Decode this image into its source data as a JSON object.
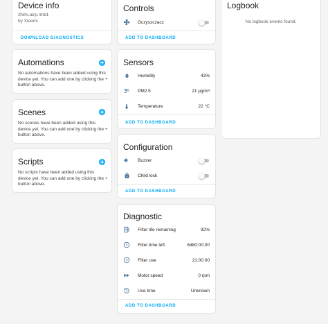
{
  "colors": {
    "accent": "#03a9f4",
    "icon": "#44739e",
    "background": "#f4f4f4"
  },
  "device_info": {
    "title": "Device info",
    "model": "zhimi.airp.rmb1",
    "manufacturer": "by Xiaomi",
    "download_label": "DOWNLOAD DIAGNOSTICS"
  },
  "automations": {
    "title": "Automations",
    "empty_text": "No automations have been added using this device yet. You can add one by clicking the + button above.",
    "add_icon": "plus-icon"
  },
  "scenes": {
    "title": "Scenes",
    "empty_text": "No scenes have been added using this device yet. You can add one by clicking the + button above.",
    "add_icon": "plus-icon"
  },
  "scripts": {
    "title": "Scripts",
    "empty_text": "No scripts have been added using this device yet. You can add one by clicking the + button above.",
    "add_icon": "plus-icon"
  },
  "controls": {
    "title": "Controls",
    "items": [
      {
        "label": "Oczyszczacz",
        "icon": "fan-icon",
        "state": "off"
      }
    ],
    "add_label": "ADD TO DASHBOARD"
  },
  "sensors": {
    "title": "Sensors",
    "items": [
      {
        "label": "Humidity",
        "value": "43%",
        "icon": "water-drop-icon"
      },
      {
        "label": "PM2.5",
        "value": "21 µg/m³",
        "icon": "blur-icon"
      },
      {
        "label": "Temperature",
        "value": "22 °C",
        "icon": "thermometer-icon"
      }
    ],
    "add_label": "ADD TO DASHBOARD"
  },
  "configuration": {
    "title": "Configuration",
    "items": [
      {
        "label": "Buzzer",
        "icon": "volume-icon",
        "state": "off"
      },
      {
        "label": "Child lock",
        "icon": "lock-icon",
        "state": "off"
      }
    ],
    "add_label": "ADD TO DASHBOARD"
  },
  "diagnostic": {
    "title": "Diagnostic",
    "items": [
      {
        "label": "Filter life remaining",
        "value": "92%",
        "icon": "filter-icon"
      },
      {
        "label": "Filter time left",
        "value": "6480:00:00",
        "icon": "clock-icon"
      },
      {
        "label": "Filter use",
        "value": "21:00:00",
        "icon": "clock-icon"
      },
      {
        "label": "Motor speed",
        "value": "0 rpm",
        "icon": "fast-forward-icon"
      },
      {
        "label": "Use time",
        "value": "Unknown",
        "icon": "history-icon"
      }
    ],
    "add_label": "ADD TO DASHBOARD"
  },
  "logbook": {
    "title": "Logbook",
    "empty_text": "No logbook events found."
  }
}
